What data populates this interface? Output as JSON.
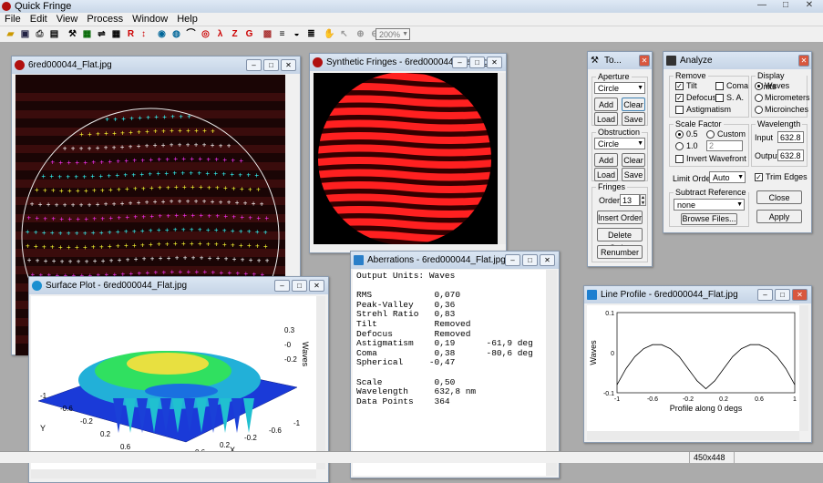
{
  "app": {
    "title": "Quick Fringe",
    "menus": [
      "File",
      "Edit",
      "View",
      "Process",
      "Window",
      "Help"
    ],
    "zoom": "200%"
  },
  "win_image": {
    "title": "6red000044_Flat.jpg"
  },
  "win_synth": {
    "title": "Synthetic Fringes - 6red000044_Flat.jpg"
  },
  "win_surface": {
    "title": "Surface Plot - 6red000044_Flat.jpg",
    "axis_waves": "Waves",
    "axis_x": "X",
    "axis_y": "Y",
    "z_ticks": [
      "0.3",
      "-0",
      "-0.2"
    ],
    "x_ticks": [
      "-1",
      "-0.6",
      "-0.2",
      "0.2",
      "0.6",
      "1"
    ],
    "y_ticks": [
      "-1",
      "-0.6",
      "-0.2",
      "0.2",
      "0.6",
      "1"
    ]
  },
  "win_tools": {
    "title": "To...",
    "aperture_label": "Aperture",
    "aperture_shape": "Circle",
    "add": "Add",
    "clear": "Clear",
    "load": "Load",
    "save": "Save",
    "obstruction_label": "Obstruction",
    "obstruction_shape": "Circle",
    "fringes_label": "Fringes",
    "order_label": "Order",
    "order_value": "13",
    "insert_order": "Insert Order",
    "delete_order": "Delete Order",
    "renumber": "Renumber"
  },
  "win_analyze": {
    "title": "Analyze",
    "remove_label": "Remove",
    "tilt": "Tilt",
    "coma": "Coma",
    "defocus": "Defocus",
    "sa": "S. A.",
    "astig": "Astigmatism",
    "display_units": "Display Units",
    "waves": "Waves",
    "micrometers": "Micrometers",
    "microinches": "Microinches",
    "scale_factor": "Scale Factor",
    "sf_05": "0.5",
    "sf_10": "1.0",
    "custom": "Custom",
    "custom_value": "2",
    "invert_wavefront": "Invert Wavefront",
    "wavelength": "Wavelength",
    "input_label": "Input",
    "input_value": "632.8",
    "output_label": "Output",
    "output_value": "632.8",
    "limit_order": "Limit Order",
    "limit_value": "Auto",
    "trim_edges": "Trim Edges",
    "subtract_ref": "Subtract Reference",
    "subtract_value": "none",
    "browse": "Browse Files...",
    "close": "Close",
    "apply": "Apply"
  },
  "win_aberr": {
    "title": "Aberrations - 6red000044_Flat.jpg",
    "lines": [
      "Output Units: Waves",
      "",
      "RMS            0,070",
      "Peak-Valley    0,36",
      "Strehl Ratio   0,83",
      "Tilt           Removed",
      "Defocus        Removed",
      "Astigmatism    0,19      -61,9 deg",
      "Coma           0,38      -80,6 deg",
      "Spherical     -0,47",
      "",
      "Scale          0,50",
      "Wavelength     632,8 nm",
      "Data Points    364"
    ]
  },
  "win_line": {
    "title": "Line Profile - 6red000044_Flat.jpg",
    "ylabel": "Waves",
    "xlabel": "Profile along 0 degs",
    "y_ticks": [
      "0.1",
      "0",
      "-0.1"
    ],
    "x_ticks": [
      "-1",
      "-0.6",
      "-0.2",
      "0.2",
      "0.6",
      "1"
    ]
  },
  "status": {
    "size": "450x448"
  },
  "chart_data": {
    "type": "line",
    "title": "",
    "xlabel": "Profile along 0 degs",
    "ylabel": "Waves",
    "xlim": [
      -1,
      1
    ],
    "ylim": [
      -0.1,
      0.1
    ],
    "x": [
      -1,
      -0.9,
      -0.8,
      -0.7,
      -0.6,
      -0.5,
      -0.4,
      -0.3,
      -0.2,
      -0.1,
      0,
      0.1,
      0.2,
      0.3,
      0.4,
      0.5,
      0.6,
      0.7,
      0.8,
      0.9,
      1
    ],
    "series": [
      {
        "values": [
          -0.08,
          -0.04,
          -0.01,
          0.01,
          0.02,
          0.02,
          0.01,
          -0.01,
          -0.04,
          -0.07,
          -0.09,
          -0.07,
          -0.04,
          -0.01,
          0.01,
          0.02,
          0.02,
          0.01,
          -0.01,
          -0.04,
          -0.08
        ]
      }
    ]
  }
}
